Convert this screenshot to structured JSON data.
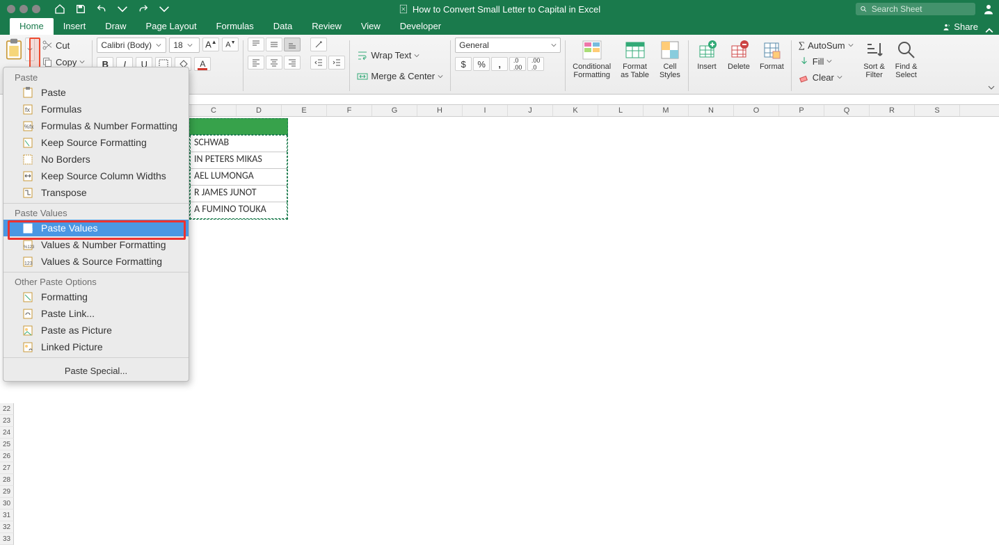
{
  "titlebar": {
    "doc_title": "How to Convert Small Letter to Capital in Excel",
    "search_placeholder": "Search Sheet"
  },
  "tabs": {
    "items": [
      "Home",
      "Insert",
      "Draw",
      "Page Layout",
      "Formulas",
      "Data",
      "Review",
      "View",
      "Developer"
    ],
    "share": "Share"
  },
  "clipboard": {
    "cut": "Cut",
    "copy": "Copy"
  },
  "font": {
    "name": "Calibri (Body)",
    "size": "18"
  },
  "alignment": {
    "wrap": "Wrap Text",
    "merge": "Merge & Center"
  },
  "number": {
    "format": "General"
  },
  "styles": {
    "cond": "Conditional\nFormatting",
    "fat": "Format\nas Table",
    "cell": "Cell\nStyles"
  },
  "cellsgrp": {
    "insert": "Insert",
    "delete": "Delete",
    "format": "Format"
  },
  "editing": {
    "autosum": "AutoSum",
    "fill": "Fill",
    "clear": "Clear",
    "sort": "Sort &\nFilter",
    "find": "Find &\nSelect"
  },
  "paste_menu": {
    "section1": "Paste",
    "items1": [
      "Paste",
      "Formulas",
      "Formulas & Number Formatting",
      "Keep Source Formatting",
      "No Borders",
      "Keep Source Column Widths",
      "Transpose"
    ],
    "section2": "Paste Values",
    "items2": [
      "Paste Values",
      "Values & Number Formatting",
      "Values & Source Formatting"
    ],
    "section3": "Other Paste Options",
    "items3": [
      "Formatting",
      "Paste Link...",
      "Paste as Picture",
      "Linked Picture"
    ],
    "special": "Paste Special..."
  },
  "grid": {
    "cols": [
      "C",
      "D",
      "E",
      "F",
      "G",
      "H",
      "I",
      "J",
      "K",
      "L",
      "M",
      "N",
      "O",
      "P",
      "Q",
      "R",
      "S"
    ],
    "rows_start": 22,
    "rows_end": 33,
    "data_cells": [
      " SCHWAB",
      "IN PETERS MIKAS",
      "AEL LUMONGA",
      "R JAMES JUNOT",
      "A FUMINO TOUKA"
    ]
  }
}
